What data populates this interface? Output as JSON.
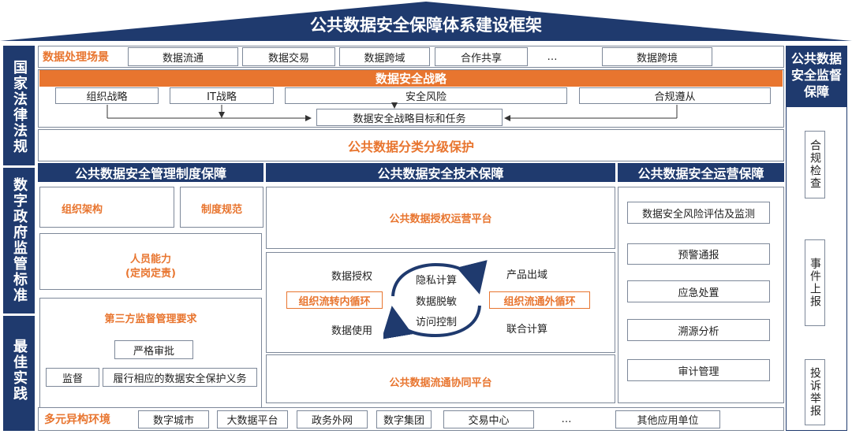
{
  "roof_title": "公共数据安全保障体系建设框架",
  "left_pillars": [
    "国家法律法规",
    "数字政府监管标准",
    "最佳实践"
  ],
  "right_pillar": {
    "title": "公共数据安全监督保障",
    "items": [
      "合规检查",
      "事件上报",
      "投诉举报"
    ]
  },
  "scenarios": {
    "label": "数据处理场景",
    "items": [
      "数据流通",
      "数据交易",
      "数据跨域",
      "合作共享",
      "…",
      "数据跨境"
    ]
  },
  "strategy": {
    "title": "数据安全战略",
    "items": [
      "组织战略",
      "IT战略",
      "安全风险",
      "合规遵从"
    ],
    "target": "数据安全战略目标和任务"
  },
  "classification": "公共数据分类分级保护",
  "management": {
    "title": "公共数据安全管理制度保障",
    "org": "组织架构",
    "rules": "制度规范",
    "staff_line1": "人员能力",
    "staff_line2": "(定岗定责)",
    "third_party": "第三方监督管理要求",
    "strict": "严格审批",
    "supervise": "监督",
    "duty": "履行相应的数据安全保护义务"
  },
  "technology": {
    "title": "公共数据安全技术保障",
    "platform_top": "公共数据授权运营平台",
    "auth": "数据授权",
    "use": "数据使用",
    "inner_loop": "组织流转内循环",
    "outer_loop": "组织流通外循环",
    "center_items": [
      "隐私计算",
      "数据脱敏",
      "访问控制"
    ],
    "product_out": "产品出域",
    "joint_compute": "联合计算",
    "platform_bottom": "公共数据流通协同平台"
  },
  "operations": {
    "title": "公共数据安全运营保障",
    "items": [
      "数据安全风险评估及监测",
      "预警通报",
      "应急处置",
      "溯源分析",
      "审计管理"
    ]
  },
  "environment": {
    "label": "多元异构环境",
    "items": [
      "数字城市",
      "大数据平台",
      "政务外网",
      "数字集团",
      "交易中心",
      "…",
      "其他应用单位"
    ]
  },
  "colors": {
    "navy": "#1f3a6e",
    "orange": "#e8752f",
    "border": "#7d8899"
  }
}
